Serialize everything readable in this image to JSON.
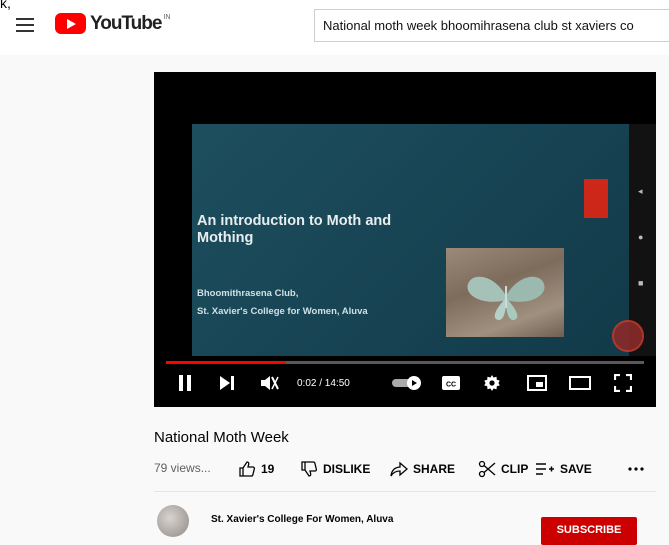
{
  "fragment_text": "k,",
  "header": {
    "logo_text": "YouTube",
    "country_code": "IN",
    "search_value": "National moth week  bhoomihrasena club st xaviers co"
  },
  "video_slide": {
    "title": "An introduction to Moth and Mothing",
    "club": "Bhoomithrasena Club,",
    "college": "St. Xavier's College for Women, Aluva"
  },
  "player": {
    "time_display": "0:02 / 14:50",
    "progress_percent": 0.25,
    "accent_color": "#ff0000"
  },
  "video": {
    "title": "National Moth Week",
    "views": "79 views..."
  },
  "actions": {
    "like_count": "19",
    "dislike_label": "DISLIKE",
    "share_label": "SHARE",
    "clip_label": "CLIP",
    "save_label": "SAVE"
  },
  "channel": {
    "name": "St. Xavier's College For Women, Aluva",
    "subscribe_label": "SUBSCRIBE"
  },
  "colors": {
    "brand": "#ff0000",
    "subscribe": "#cc0000",
    "slide_bg": "#174353"
  }
}
